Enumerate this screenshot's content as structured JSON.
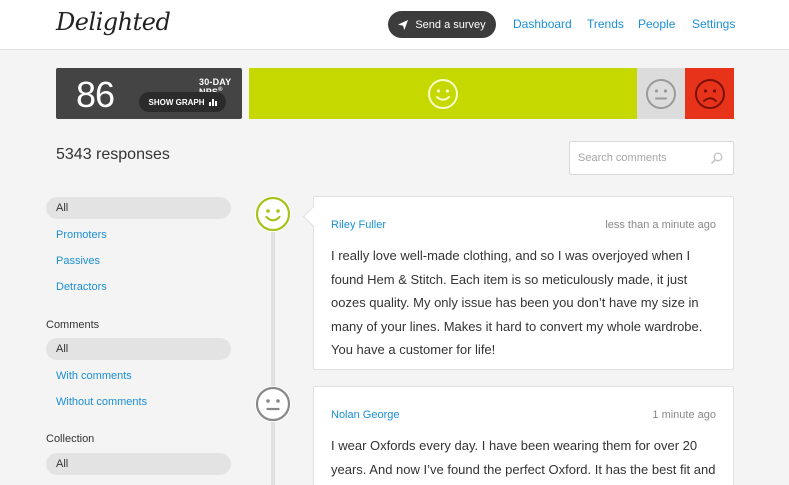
{
  "header": {
    "logo": "Delighted",
    "send_button_label": "Send a survey",
    "nav": [
      "Dashboard",
      "Trends",
      "People",
      "Settings"
    ]
  },
  "nps": {
    "score": "86",
    "label": "30-DAY NPS",
    "label_mark": "®",
    "show_graph_label": "SHOW GRAPH",
    "breakdown": {
      "promoters": 0.79,
      "passives": 0.1,
      "detractors": 0.11
    }
  },
  "responses_count": "5343 responses",
  "search": {
    "placeholder": "Search comments",
    "value": ""
  },
  "filters": {
    "score_group": {
      "all": "All",
      "promoters": "Promoters",
      "passives": "Passives",
      "detractors": "Detractors"
    },
    "comments_group": {
      "heading": "Comments",
      "all": "All",
      "with": "With comments",
      "without": "Without comments"
    },
    "collection_group": {
      "heading": "Collection",
      "all": "All"
    }
  },
  "responses": [
    {
      "type": "promoter",
      "name": "Riley Fuller",
      "time": "less than a minute ago",
      "text": "I really love well-made clothing, and so I was overjoyed when I found Hem & Stitch. Each item is so meticulously made, it just oozes quality. My only issue has been you don’t have my size in many of your lines. Makes it hard to convert my whole wardrobe. You have a customer for life!"
    },
    {
      "type": "passive",
      "name": "Nolan George",
      "time": "1 minute ago",
      "text": "I wear Oxfords every day. I have been wearing them for over 20 years. And now I’ve found the perfect Oxford. It has the best fit and the right amount of quality."
    }
  ],
  "colors": {
    "promoter": "#c5d900",
    "passive": "#dcdcdc",
    "detractor": "#e8331b",
    "link": "#1b8fd6",
    "dark": "#444444"
  }
}
